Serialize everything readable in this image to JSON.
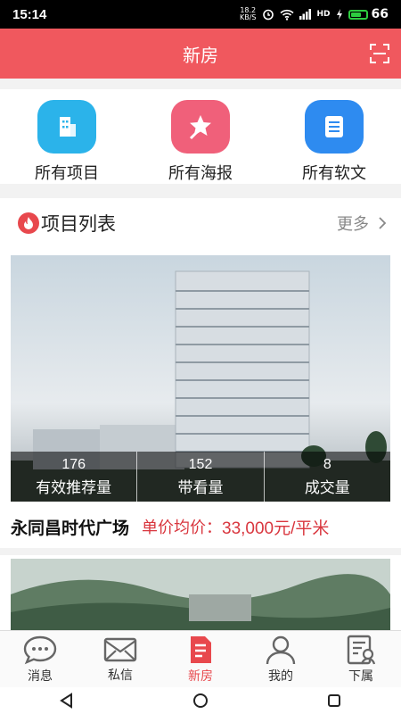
{
  "status_bar": {
    "time": "15:14",
    "net_speed_top": "18.2",
    "net_speed_unit": "KB/S",
    "signal_tag": "HD",
    "battery": "66"
  },
  "header": {
    "title": "新房"
  },
  "quick_links": [
    {
      "label": "所有项目",
      "icon": "building-icon",
      "color": "#2bb3ea"
    },
    {
      "label": "所有海报",
      "icon": "star-icon",
      "color": "#f0607a"
    },
    {
      "label": "所有软文",
      "icon": "document-icon",
      "color": "#2e8bf0"
    }
  ],
  "project_list": {
    "title": "项目列表",
    "more": "更多"
  },
  "project": {
    "stats": [
      {
        "value": "176",
        "label": "有效推荐量"
      },
      {
        "value": "152",
        "label": "带看量"
      },
      {
        "value": "8",
        "label": "成交量"
      }
    ],
    "name": "永同昌时代广场",
    "price_label": "单价均价：",
    "price_value": "33,000元/平米"
  },
  "tabs": [
    {
      "label": "消息",
      "icon": "chat-icon",
      "active": false
    },
    {
      "label": "私信",
      "icon": "mail-icon",
      "active": false
    },
    {
      "label": "新房",
      "icon": "house-doc-icon",
      "active": true
    },
    {
      "label": "我的",
      "icon": "user-icon",
      "active": false
    },
    {
      "label": "下属",
      "icon": "subordinate-icon",
      "active": false
    }
  ],
  "colors": {
    "brand": "#f0585e",
    "price": "#d9363e"
  }
}
